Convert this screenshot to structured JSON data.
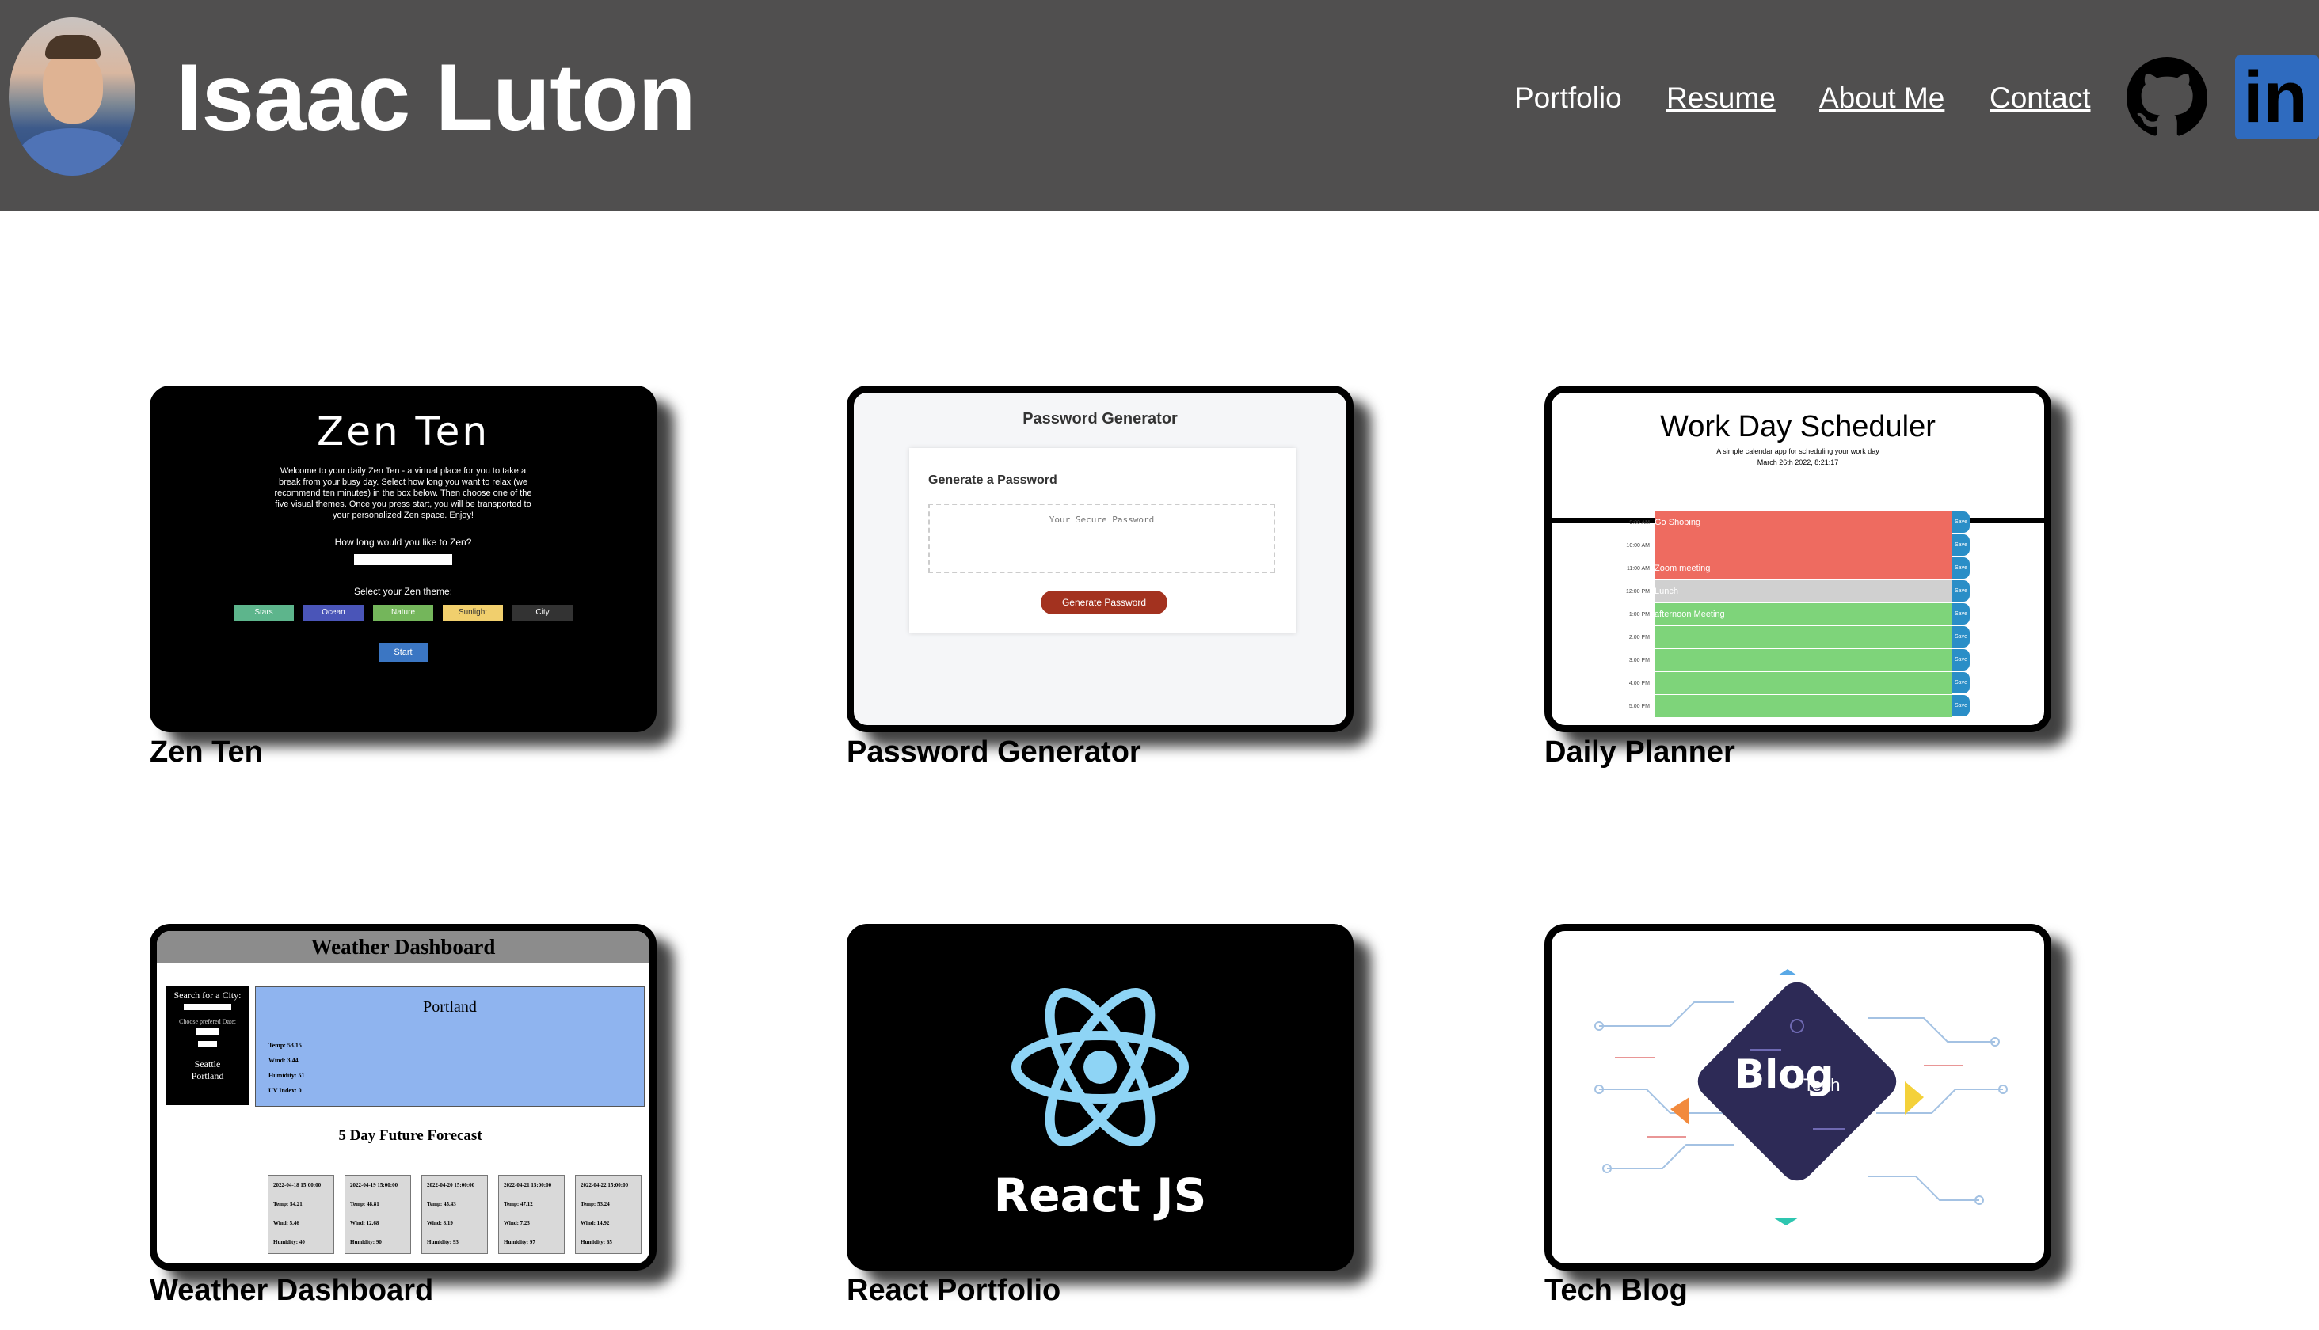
{
  "header": {
    "name": "Isaac Luton",
    "nav": [
      {
        "label": "Portfolio"
      },
      {
        "label": "Resume"
      },
      {
        "label": "About Me"
      },
      {
        "label": "Contact"
      }
    ],
    "icons": [
      "github-icon",
      "linkedin-icon"
    ],
    "linkedin_text": "in",
    "background": "#504f4f"
  },
  "projects": [
    {
      "label": "Zen Ten",
      "preview": {
        "title": "Zen Ten",
        "description": "Welcome to your daily Zen Ten - a virtual place for you to take a break from your busy day. Select how long you want to relax (we recommend ten minutes) in the box below. Then choose one of the five visual themes. Once you press start, you will be transported to your personalized Zen space. Enjoy!",
        "question": "How long would you like to Zen?",
        "select_label": "Select your Zen theme:",
        "themes": [
          "Stars",
          "Ocean",
          "Nature",
          "Sunlight",
          "City"
        ],
        "start": "Start"
      }
    },
    {
      "label": "Password Generator",
      "preview": {
        "title": "Password Generator",
        "card_title": "Generate a Password",
        "placeholder": "Your Secure Password",
        "button": "Generate Password"
      }
    },
    {
      "label": "Daily Planner",
      "preview": {
        "title": "Work Day Scheduler",
        "subtitle": "A simple calendar app for scheduling your work day",
        "date": "March 26th 2022, 8:21:17",
        "rows": [
          {
            "time": "9:00 AM",
            "event": "Go Shoping",
            "state": "past"
          },
          {
            "time": "10:00 AM",
            "event": "",
            "state": "past"
          },
          {
            "time": "11:00 AM",
            "event": "Zoom meeting",
            "state": "past"
          },
          {
            "time": "12:00 PM",
            "event": "Lunch",
            "state": "present"
          },
          {
            "time": "1:00 PM",
            "event": "afternoon Meeting",
            "state": "future"
          },
          {
            "time": "2:00 PM",
            "event": "",
            "state": "future"
          },
          {
            "time": "3:00 PM",
            "event": "",
            "state": "future"
          },
          {
            "time": "4:00 PM",
            "event": "",
            "state": "future"
          },
          {
            "time": "5:00 PM",
            "event": "",
            "state": "future"
          }
        ],
        "save": "Save"
      }
    },
    {
      "label": "Weather Dashboard",
      "preview": {
        "title": "Weather Dashboard",
        "search_label": "Search for a City:",
        "date_label": "Choose prefered Date:",
        "history": [
          "Seattle",
          "Portland"
        ],
        "city": "Portland",
        "current": [
          "Temp: 53.15",
          "Wind: 3.44",
          "Humidity: 51",
          "UV Index: 0"
        ],
        "forecast_heading": "5 Day Future Forecast",
        "forecast": [
          {
            "date": "2022-04-18 15:00:00",
            "temp": "Temp: 54.21",
            "wind": "Wind: 5.46",
            "humidity": "Humidity: 40"
          },
          {
            "date": "2022-04-19 15:00:00",
            "temp": "Temp: 48.81",
            "wind": "Wind: 12.68",
            "humidity": "Humidity: 90"
          },
          {
            "date": "2022-04-20 15:00:00",
            "temp": "Temp: 45.43",
            "wind": "Wind: 8.19",
            "humidity": "Humidity: 93"
          },
          {
            "date": "2022-04-21 15:00:00",
            "temp": "Temp: 47.12",
            "wind": "Wind: 7.23",
            "humidity": "Humidity: 97"
          },
          {
            "date": "2022-04-22 15:00:00",
            "temp": "Temp: 53.24",
            "wind": "Wind: 14.92",
            "humidity": "Humidity: 65"
          }
        ]
      }
    },
    {
      "label": "React Portfolio",
      "preview": {
        "title": "React JS"
      }
    },
    {
      "label": "Tech Blog",
      "preview": {
        "title": "Blog",
        "subtitle": "Tech"
      }
    }
  ],
  "colors": {
    "header_bg": "#504f4f",
    "planner_past": "#ee6b60",
    "planner_present": "#d0d0d0",
    "planner_future": "#7ed47a",
    "password_button": "#a3321f",
    "react_atom": "#8ed4f5"
  }
}
